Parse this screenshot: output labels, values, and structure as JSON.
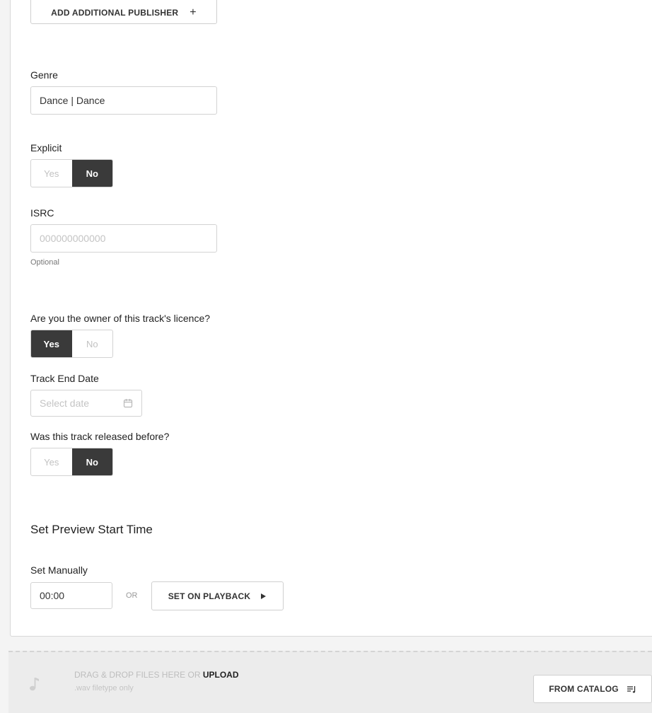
{
  "publisher": {
    "add_label": "ADD ADDITIONAL PUBLISHER",
    "add_icon": "+"
  },
  "genre": {
    "label": "Genre",
    "value": "Dance | Dance"
  },
  "explicit": {
    "label": "Explicit",
    "yes": "Yes",
    "no": "No",
    "selected": "No"
  },
  "isrc": {
    "label": "ISRC",
    "placeholder": "000000000000",
    "hint": "Optional"
  },
  "licence": {
    "label": "Are you the owner of this track's licence?",
    "yes": "Yes",
    "no": "No",
    "selected": "Yes"
  },
  "track_end": {
    "label": "Track End Date",
    "placeholder": "Select date",
    "icon": "calendar-icon"
  },
  "released_before": {
    "label": "Was this track released before?",
    "yes": "Yes",
    "no": "No",
    "selected": "No"
  },
  "preview": {
    "title": "Set Preview Start Time",
    "manual_label": "Set Manually",
    "time_value": "00:00",
    "or_label": "OR",
    "playback_label": "SET ON PLAYBACK",
    "playback_icon": "play-icon"
  },
  "dropzone": {
    "text_prefix": "DRAG & DROP FILES HERE OR",
    "upload_label": "UPLOAD",
    "filetype_hint": ".wav filetype only",
    "catalog_label": "FROM CATALOG",
    "catalog_icon": "playlist-icon",
    "music_icon": "music-note-icon"
  }
}
